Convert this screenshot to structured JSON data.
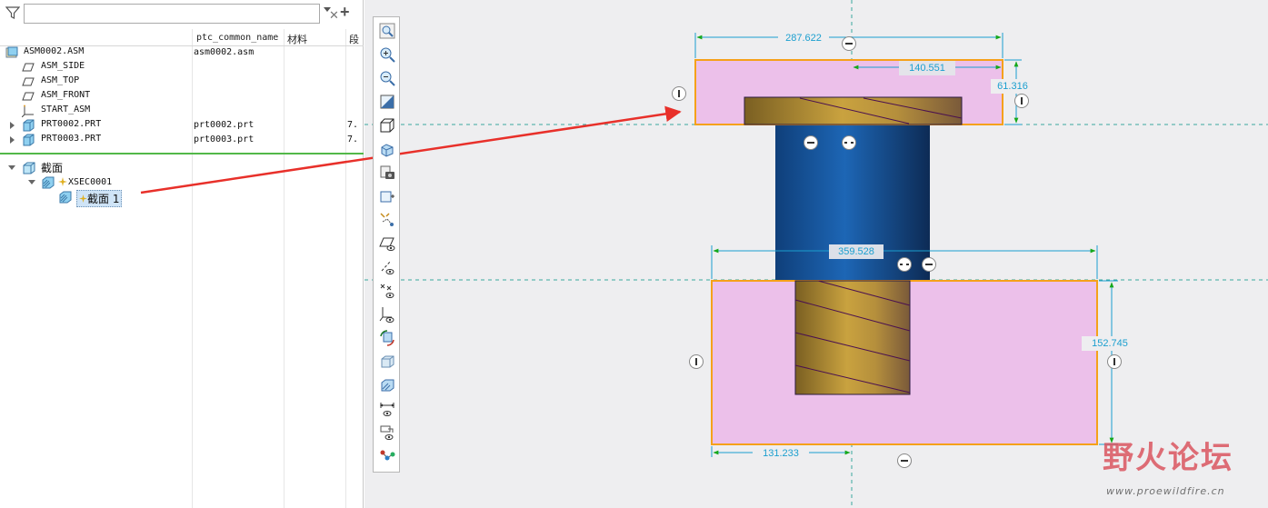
{
  "search": {
    "value": "",
    "placeholder": ""
  },
  "columns": {
    "name_param": "ptc_common_name",
    "material": "材料",
    "extra": "段"
  },
  "tree_rows": [
    {
      "label": "ASM0002.ASM",
      "common_name": "asm0002.asm",
      "extra": "",
      "icon": "assembly-icon"
    },
    {
      "label": "ASM_SIDE",
      "common_name": "",
      "extra": "",
      "icon": "datum-plane-icon"
    },
    {
      "label": "ASM_TOP",
      "common_name": "",
      "extra": "",
      "icon": "datum-plane-icon"
    },
    {
      "label": "ASM_FRONT",
      "common_name": "",
      "extra": "",
      "icon": "datum-plane-icon"
    },
    {
      "label": "START_ASM",
      "common_name": "",
      "extra": "",
      "icon": "coordinate-system-icon"
    },
    {
      "label": "PRT0002.PRT",
      "common_name": "prt0002.prt",
      "extra": "7.",
      "icon": "part-icon"
    },
    {
      "label": "PRT0003.PRT",
      "common_name": "prt0003.prt",
      "extra": "7.",
      "icon": "part-icon"
    }
  ],
  "section_tree": {
    "root": "截面",
    "child": "XSEC0001",
    "grandchild": "截面 1"
  },
  "dimensions": {
    "top_width": "287.622",
    "top_offset": "140.551",
    "top_height": "61.316",
    "bottom_width": "359.528",
    "bottom_height": "152.745",
    "bottom_offset": "131.233"
  },
  "watermark": {
    "text": "野火论坛",
    "url": "www.proewildfire.cn"
  },
  "colors": {
    "section_fill": "#ecc0ea",
    "outline": "#f5a11a",
    "bolt_gold": "#c8a040",
    "shaft_blue": "#1e64b0",
    "dimension": "#1b9fcf",
    "arrow": "#e8302a",
    "tree_separator": "#52b848"
  },
  "toolbar_icons": [
    "zoom-fit-icon",
    "zoom-in-icon",
    "zoom-out-icon",
    "refit-icon",
    "display-style-icon",
    "saved-orientations-icon",
    "view-manager-icon",
    "perspective-icon",
    "datum-display-icon",
    "plane-display-icon",
    "axis-display-icon",
    "point-display-icon",
    "csys-display-icon",
    "spin-center-icon",
    "annotation-display-icon",
    "section-display-icon",
    "dimension-display-icon",
    "named-view-icon",
    "repaint-icon"
  ]
}
